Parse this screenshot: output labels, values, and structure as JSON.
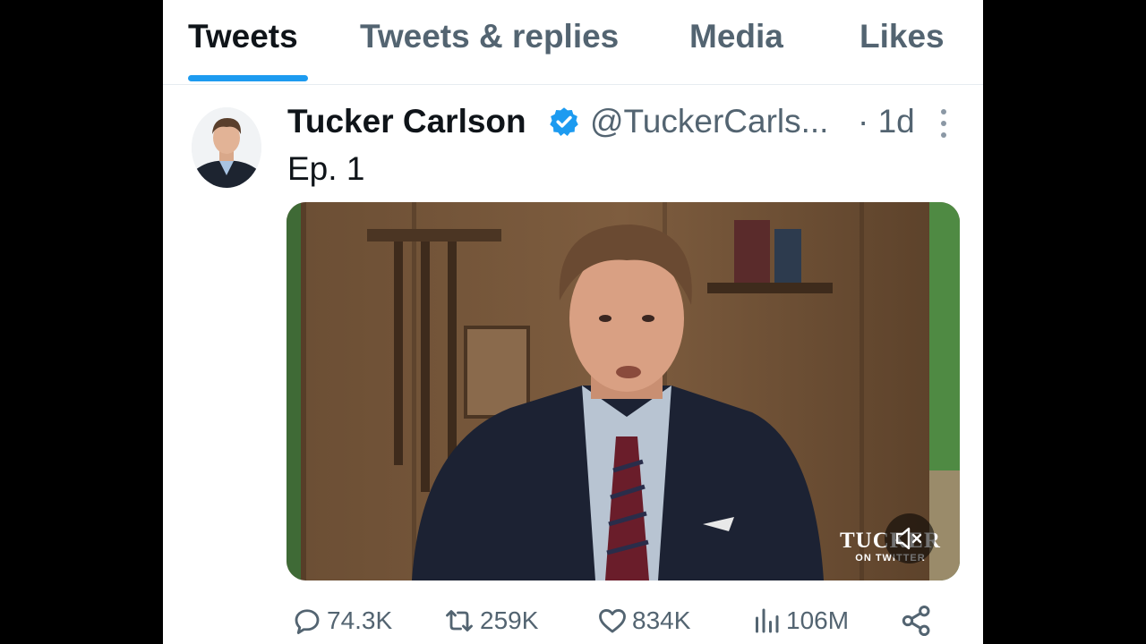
{
  "tabs": [
    {
      "label": "Tweets",
      "active": true
    },
    {
      "label": "Tweets & replies",
      "active": false
    },
    {
      "label": "Media",
      "active": false
    },
    {
      "label": "Likes",
      "active": false
    }
  ],
  "tweet": {
    "author_name": "Tucker Carlson",
    "handle": "@TuckerCarls...",
    "time": "· 1d",
    "verified": true,
    "text": "Ep. 1",
    "media": {
      "type": "video",
      "overlay_brand_line1": "TUCKER",
      "overlay_brand_line2": "ON TWITTER",
      "muted": true
    },
    "stats": {
      "replies": "74.3K",
      "retweets": "259K",
      "likes": "834K",
      "views": "106M"
    }
  },
  "colors": {
    "accent": "#1d9bf0",
    "text_primary": "#0f1419",
    "text_secondary": "#536471"
  },
  "icons": {
    "verified": "verified-badge-icon",
    "more": "more-vertical-icon",
    "reply": "reply-icon",
    "retweet": "retweet-icon",
    "like": "heart-icon",
    "views": "views-icon",
    "share": "share-icon",
    "mute": "speaker-muted-icon"
  }
}
